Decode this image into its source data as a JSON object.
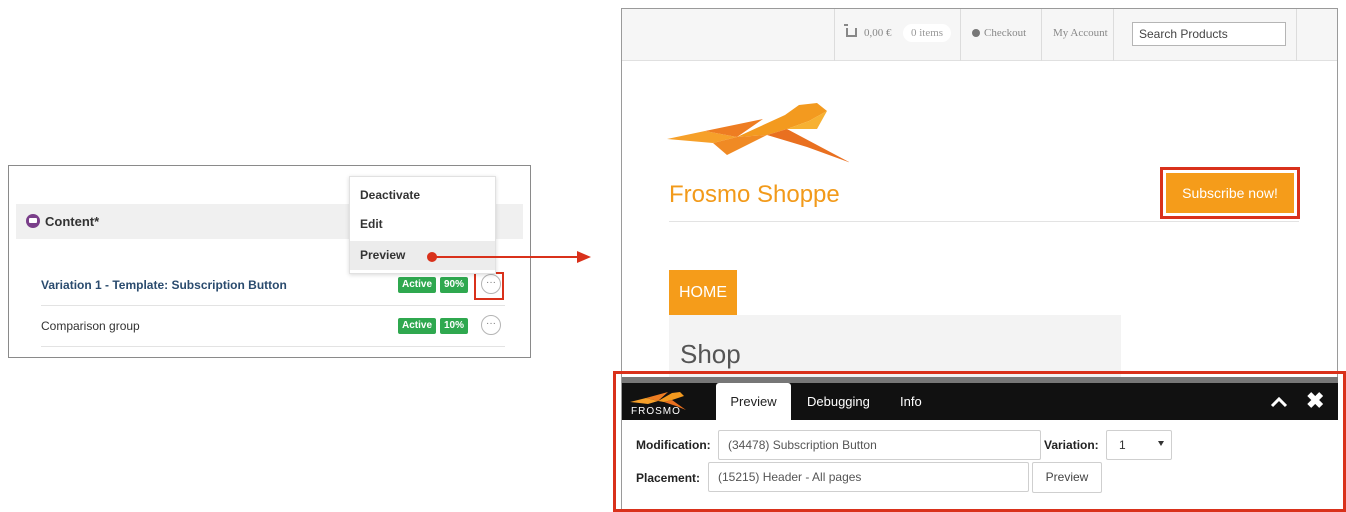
{
  "left_panel": {
    "section_title": "Content*",
    "menu": {
      "items": [
        "Deactivate",
        "Edit",
        "Preview"
      ]
    },
    "rows": [
      {
        "label": "Variation 1 - Template: Subscription Button",
        "status": "Active",
        "percent": "90%"
      },
      {
        "label": "Comparison group",
        "status": "Active",
        "percent": "10%"
      }
    ],
    "more_glyph": "···"
  },
  "shop": {
    "cart_price": "0,00 €",
    "cart_items": "0 items",
    "checkout": "Checkout",
    "my_account": "My Account",
    "search_placeholder": "Search Products",
    "title": "Frosmo Shoppe",
    "subscribe": "Subscribe now!",
    "home_tab": "HOME",
    "heading": "Shop"
  },
  "toolbar": {
    "brand": "FROSMO",
    "tabs": [
      "Preview",
      "Debugging",
      "Info"
    ],
    "modification_label": "Modification:",
    "modification_value": "(34478) Subscription Button",
    "variation_label": "Variation:",
    "variation_value": "1",
    "placement_label": "Placement:",
    "placement_value": "(15215) Header - All pages",
    "preview_button": "Preview"
  },
  "colors": {
    "accent_orange": "#f59c1a",
    "highlight_red": "#d9311b",
    "active_green": "#2fa84f"
  },
  "icons": [
    "content-icon",
    "more-icon",
    "cart-icon",
    "checkout-icon",
    "frosmo-logo",
    "cheetah-logo",
    "chevron-up-icon",
    "close-icon",
    "select-caret-icon"
  ]
}
